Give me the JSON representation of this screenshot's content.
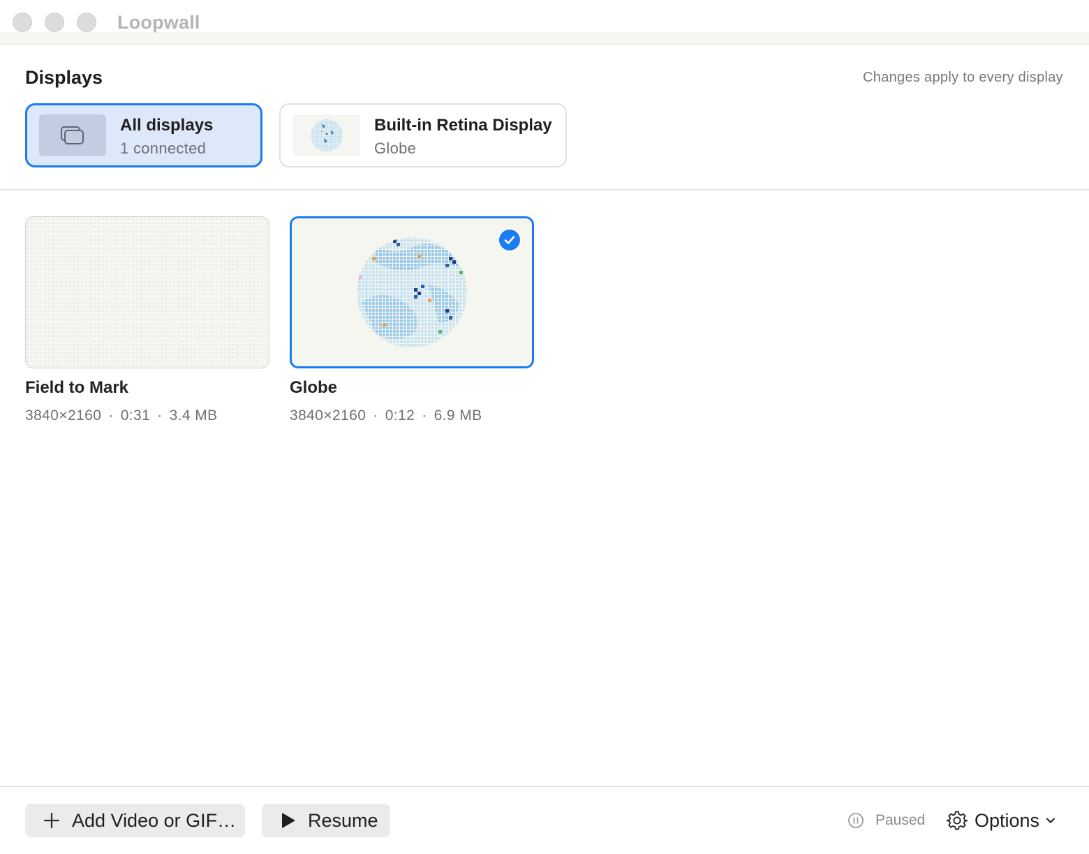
{
  "window": {
    "title": "Loopwall"
  },
  "displays": {
    "title": "Displays",
    "note": "Changes apply to every display",
    "items": [
      {
        "name": "All displays",
        "subtitle": "1 connected",
        "icon": "stacked-windows-icon",
        "selected": true
      },
      {
        "name": "Built-in Retina Display",
        "subtitle": "Globe",
        "icon": "globe-thumbnail",
        "selected": false
      }
    ]
  },
  "wallpapers": [
    {
      "name": "Field to Mark",
      "resolution": "3840×2160",
      "duration": "0:31",
      "size": "3.4 MB",
      "selected": false
    },
    {
      "name": "Globe",
      "resolution": "3840×2160",
      "duration": "0:12",
      "size": "6.9 MB",
      "selected": true
    }
  ],
  "meta_separator": "·",
  "toolbar": {
    "add_label": "Add Video or GIF…",
    "resume_label": "Resume",
    "status_label": "Paused",
    "options_label": "Options"
  },
  "colors": {
    "accent": "#1a7cf0",
    "selected_bg": "#dde8fb"
  }
}
